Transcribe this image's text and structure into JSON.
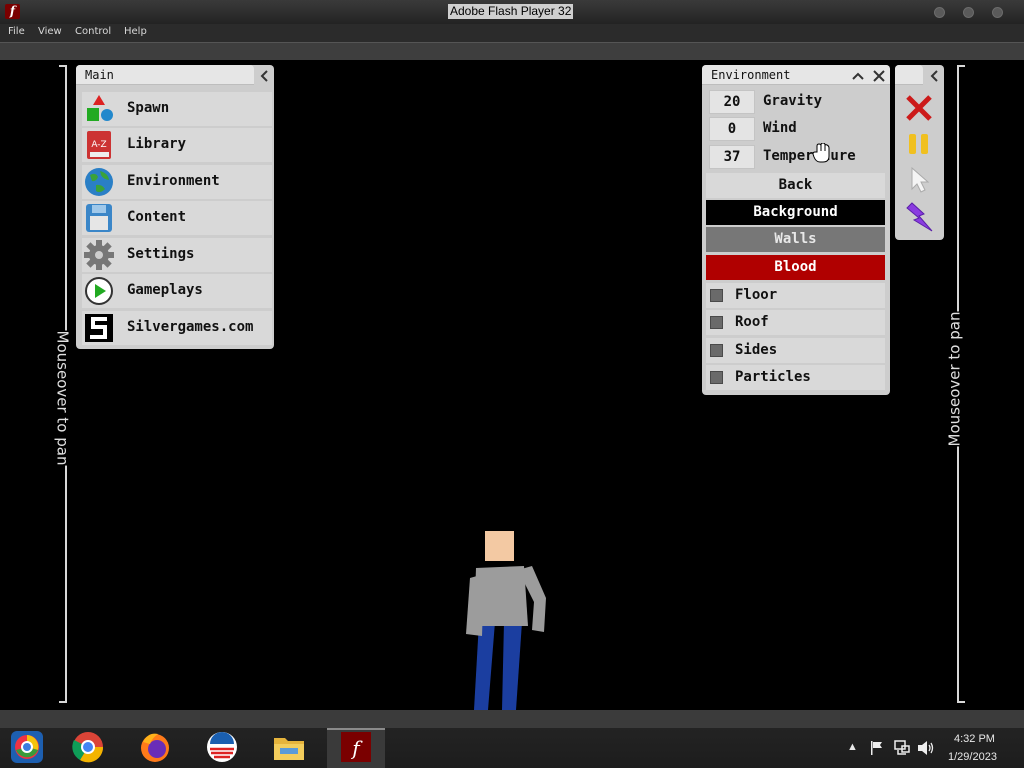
{
  "window": {
    "title": "Adobe Flash Player 32",
    "app_icon": "flash-icon"
  },
  "menubar": {
    "items": [
      "File",
      "View",
      "Control",
      "Help"
    ]
  },
  "pan_hint": {
    "left": "Mouseover to pan",
    "right": "Mouseover to pan"
  },
  "main_panel": {
    "title": "Main",
    "collapse_icon": "chevron-left-icon",
    "items": [
      {
        "label": "Spawn",
        "icon": "shapes-icon"
      },
      {
        "label": "Library",
        "icon": "a-z-book-icon"
      },
      {
        "label": "Environment",
        "icon": "globe-icon"
      },
      {
        "label": "Content",
        "icon": "floppy-disk-icon"
      },
      {
        "label": "Settings",
        "icon": "gear-icon"
      },
      {
        "label": "Gameplays",
        "icon": "play-icon"
      },
      {
        "label": "Silvergames.com",
        "icon": "silvergames-logo-icon"
      }
    ]
  },
  "environment_panel": {
    "title": "Environment",
    "fields": [
      {
        "value": "20",
        "label": "Gravity"
      },
      {
        "value": "0",
        "label": "Wind"
      },
      {
        "value": "37",
        "label": "Temperature"
      }
    ],
    "back_label": "Back",
    "color_buttons": [
      {
        "label": "Background",
        "bg": "#000000",
        "fg": "#ffffff"
      },
      {
        "label": "Walls",
        "bg": "#777777",
        "fg": "#e8e8e8"
      },
      {
        "label": "Blood",
        "bg": "#b00000",
        "fg": "#ffffff"
      }
    ],
    "checkboxes": [
      {
        "label": "Floor"
      },
      {
        "label": "Roof"
      },
      {
        "label": "Sides"
      },
      {
        "label": "Particles"
      }
    ]
  },
  "tool_panel": {
    "tools": [
      "close-x-icon",
      "pause-icon",
      "cursor-icon",
      "lightning-icon"
    ]
  },
  "taskbar": {
    "apps": [
      "chromium-icon",
      "chrome-icon",
      "firefox-icon",
      "campaign-logo-icon",
      "file-explorer-icon",
      "flash-player-icon"
    ],
    "time": "4:32 PM",
    "date": "1/29/2023"
  },
  "colors": {
    "panel_bg": "#cdcdcd",
    "flash_red": "#7a0000"
  }
}
